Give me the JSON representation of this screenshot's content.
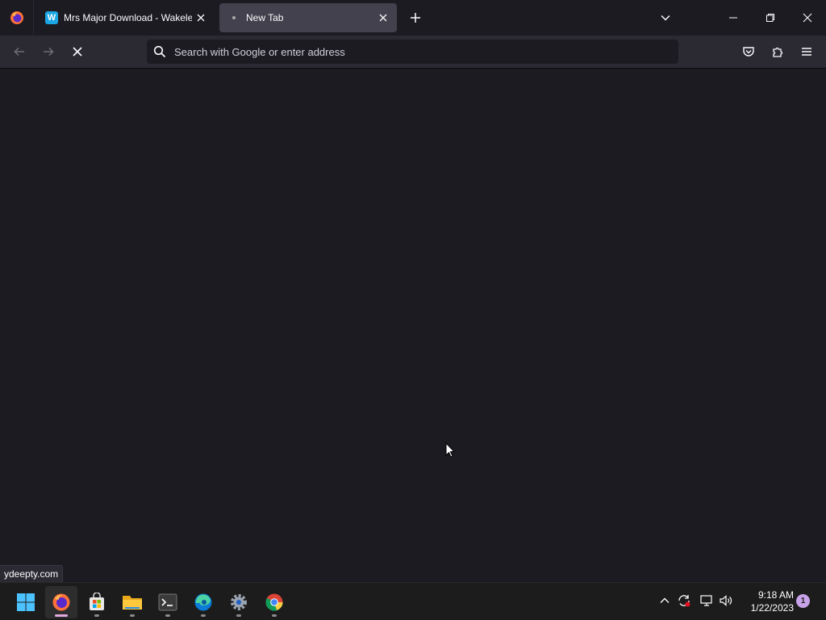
{
  "browser": {
    "tabs": [
      {
        "title": "Mrs Major Download - Wakelet",
        "favicon": "W",
        "active": false
      },
      {
        "title": "New Tab",
        "active": true
      }
    ],
    "urlbar": {
      "placeholder": "Search with Google or enter address",
      "value": ""
    },
    "status_text": "ydeepty.com"
  },
  "icons": {
    "firefox_menu": "firefox-icon",
    "back": "arrow-left-icon",
    "forward": "arrow-right-icon",
    "stop": "stop-icon",
    "pocket": "pocket-icon",
    "extensions": "puzzle-icon",
    "menu": "hamburger-icon"
  },
  "taskbar": {
    "apps": [
      {
        "name": "start",
        "active": false
      },
      {
        "name": "firefox",
        "active": true
      },
      {
        "name": "microsoft-store",
        "active": false
      },
      {
        "name": "file-explorer",
        "active": false
      },
      {
        "name": "terminal",
        "active": false
      },
      {
        "name": "edge",
        "active": false
      },
      {
        "name": "settings",
        "active": false
      },
      {
        "name": "chrome",
        "active": false
      }
    ],
    "clock": {
      "time": "9:18 AM",
      "date": "1/22/2023"
    },
    "notification_count": "1"
  },
  "colors": {
    "chrome_bg": "#1c1b22",
    "toolbar_bg": "#2b2a33",
    "active_tab": "#42414d",
    "accent": "#e3a8e0"
  }
}
